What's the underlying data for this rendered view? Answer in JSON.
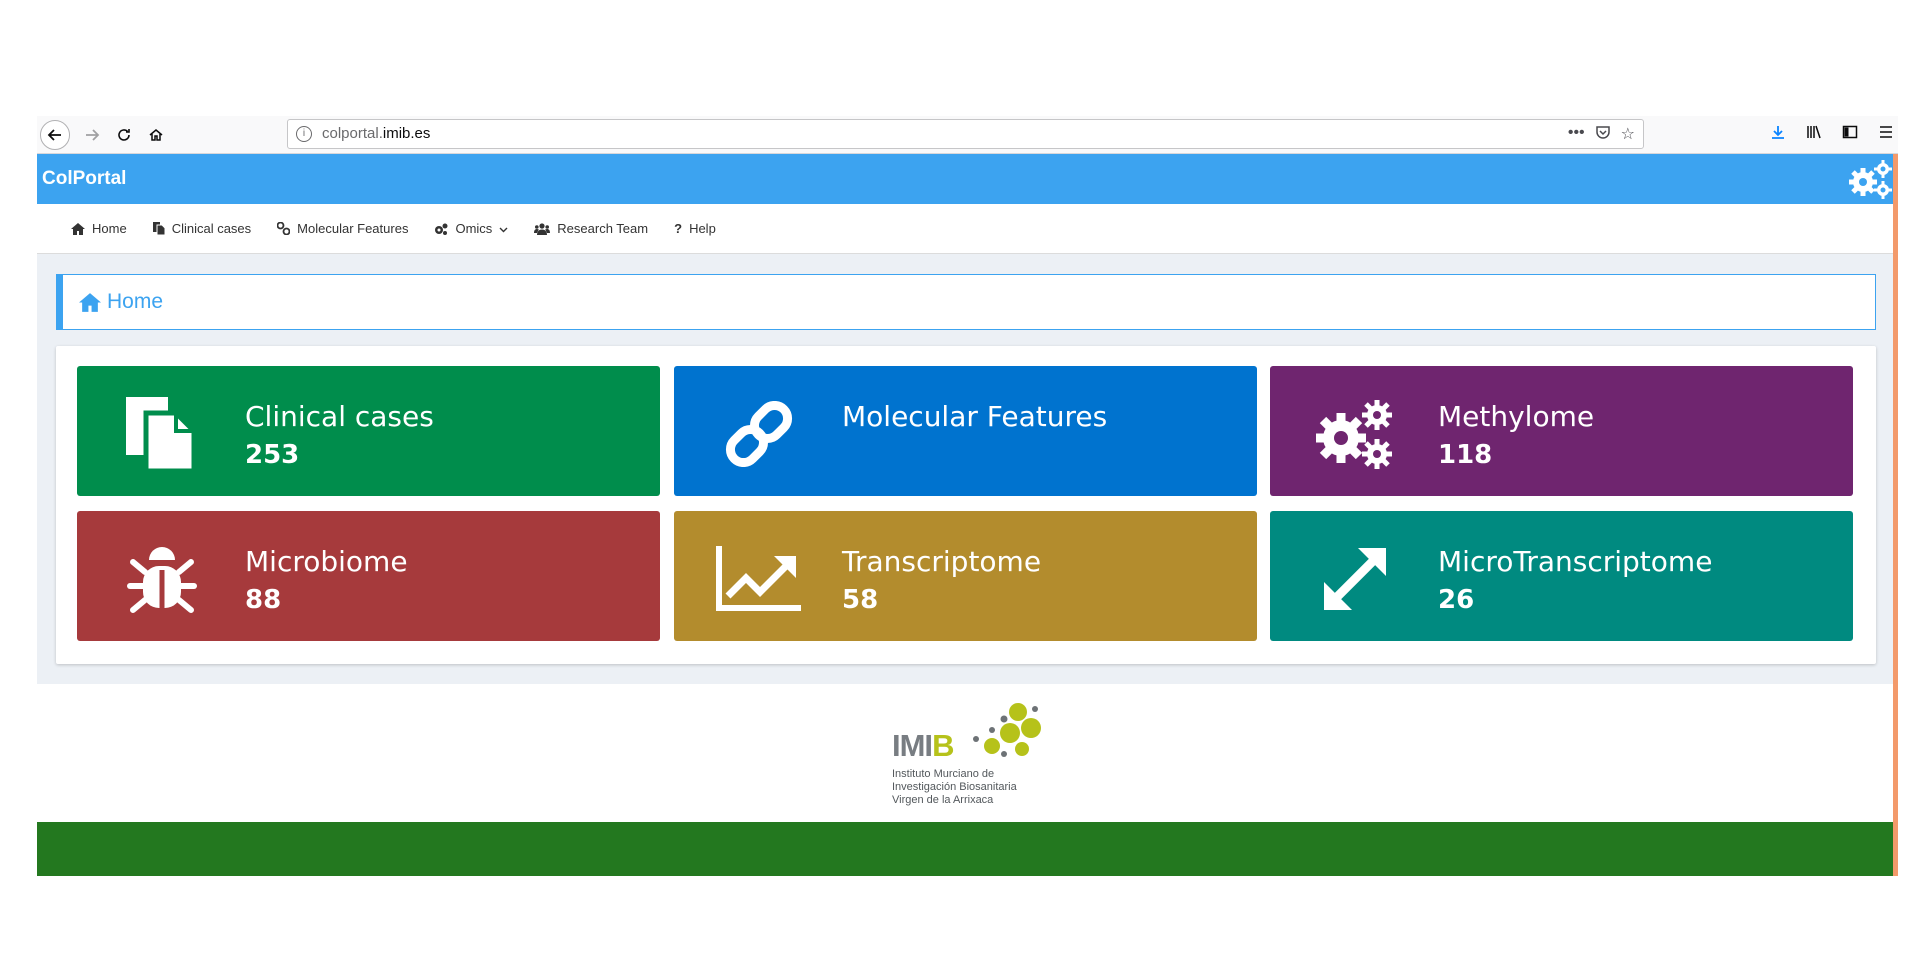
{
  "browser": {
    "url_prefix": "colportal.",
    "url_domain": "imib.es",
    "icons": [
      "back-icon",
      "forward-icon",
      "reload-icon",
      "home-icon",
      "info-icon",
      "more-icon",
      "pocket-icon",
      "bookmark-star-icon",
      "download-icon",
      "library-icon",
      "sidebar-icon",
      "menu-icon"
    ]
  },
  "app": {
    "brand": "ColPortal",
    "header_color": "#3ca3f0"
  },
  "nav": {
    "items": [
      {
        "label": "Home",
        "icon": "home-icon"
      },
      {
        "label": "Clinical cases",
        "icon": "copy-icon"
      },
      {
        "label": "Molecular Features",
        "icon": "link-icon"
      },
      {
        "label": "Omics",
        "icon": "cogs-icon"
      },
      {
        "label": "Research Team",
        "icon": "users-icon"
      },
      {
        "label": "Help",
        "icon": "question-icon"
      }
    ]
  },
  "breadcrumb": {
    "label": "Home",
    "icon": "home-icon"
  },
  "tiles": [
    {
      "title": "Clinical cases",
      "count": "253",
      "color": "#008d4c",
      "icon": "copy-icon"
    },
    {
      "title": "Molecular Features",
      "count": "",
      "color": "#0073cf",
      "icon": "link-icon"
    },
    {
      "title": "Methylome",
      "count": "118",
      "color": "#6f256f",
      "icon": "cogs-icon"
    },
    {
      "title": "Microbiome",
      "count": "88",
      "color": "#a63a3c",
      "icon": "bug-icon"
    },
    {
      "title": "Transcriptome",
      "count": "58",
      "color": "#b38c2d",
      "icon": "line-chart-icon"
    },
    {
      "title": "MicroTranscriptome",
      "count": "26",
      "color": "#008a80",
      "icon": "expand-icon"
    }
  ],
  "footer": {
    "logo_name_a": "IMI",
    "logo_name_b": "B",
    "logo_line1": "Instituto Murciano de",
    "logo_line2": "Investigación Biosanitaria",
    "logo_line3": "Virgen de la Arrixaca",
    "bar_color": "#23781f"
  }
}
